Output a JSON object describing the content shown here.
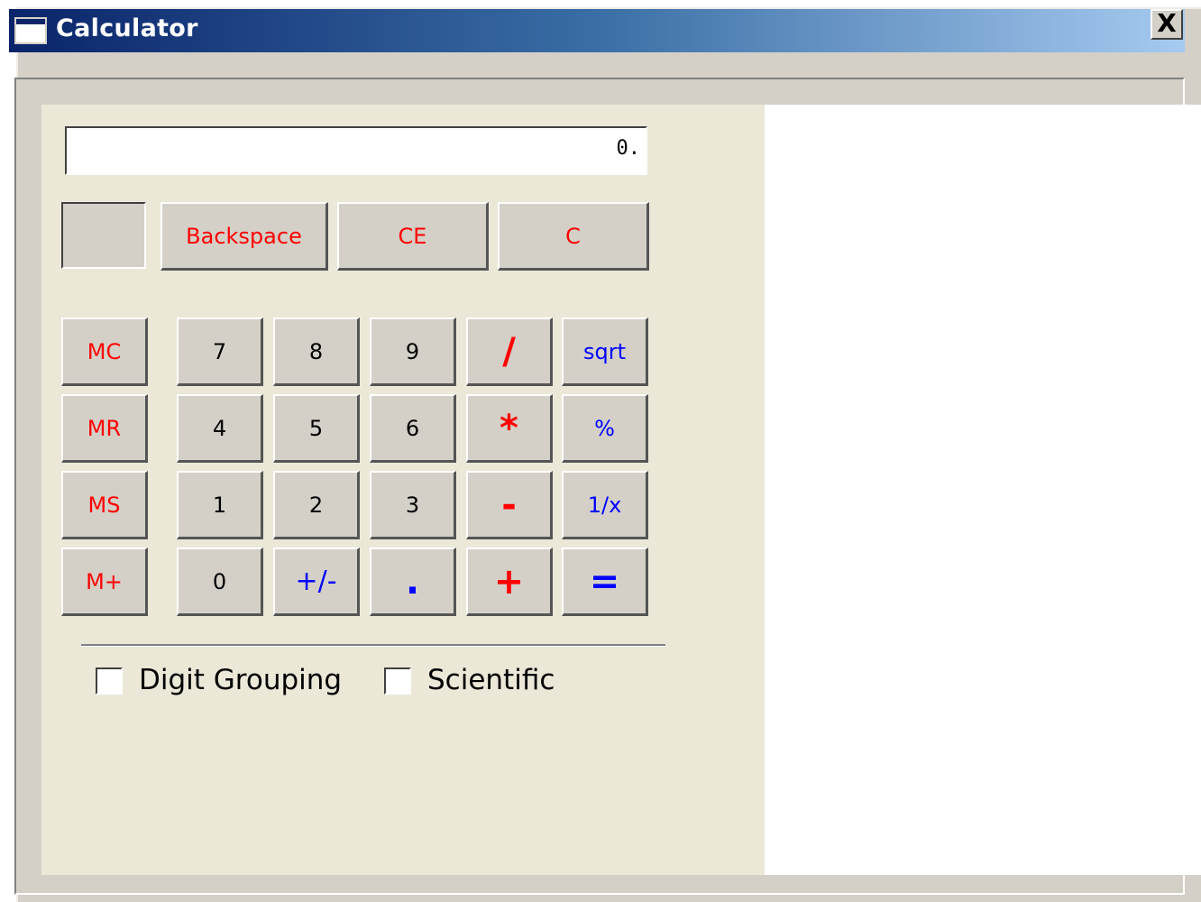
{
  "window": {
    "title": "Calculator",
    "close_label": "X"
  },
  "display": {
    "value": "0."
  },
  "memory_indicator": {
    "value": ""
  },
  "top_buttons": [
    {
      "label": "Backspace"
    },
    {
      "label": "CE"
    },
    {
      "label": "C"
    }
  ],
  "memory_buttons": [
    "MC",
    "MR",
    "MS",
    "M+"
  ],
  "keypad": {
    "row1": [
      "7",
      "8",
      "9",
      "/",
      "sqrt"
    ],
    "row2": [
      "4",
      "5",
      "6",
      "*",
      "%"
    ],
    "row3": [
      "1",
      "2",
      "3",
      "-",
      "1/x"
    ],
    "row4": [
      "0",
      "+/-",
      ".",
      "+",
      "="
    ]
  },
  "options": {
    "digit_grouping": {
      "label": "Digit Grouping",
      "checked": false
    },
    "scientific": {
      "label": "Scientific",
      "checked": false
    }
  },
  "colors": {
    "digit": "#000000",
    "operator_red": "#ff0000",
    "function_blue": "#0000ff",
    "face": "#d4d0c8",
    "panel": "#ebe8d8"
  }
}
